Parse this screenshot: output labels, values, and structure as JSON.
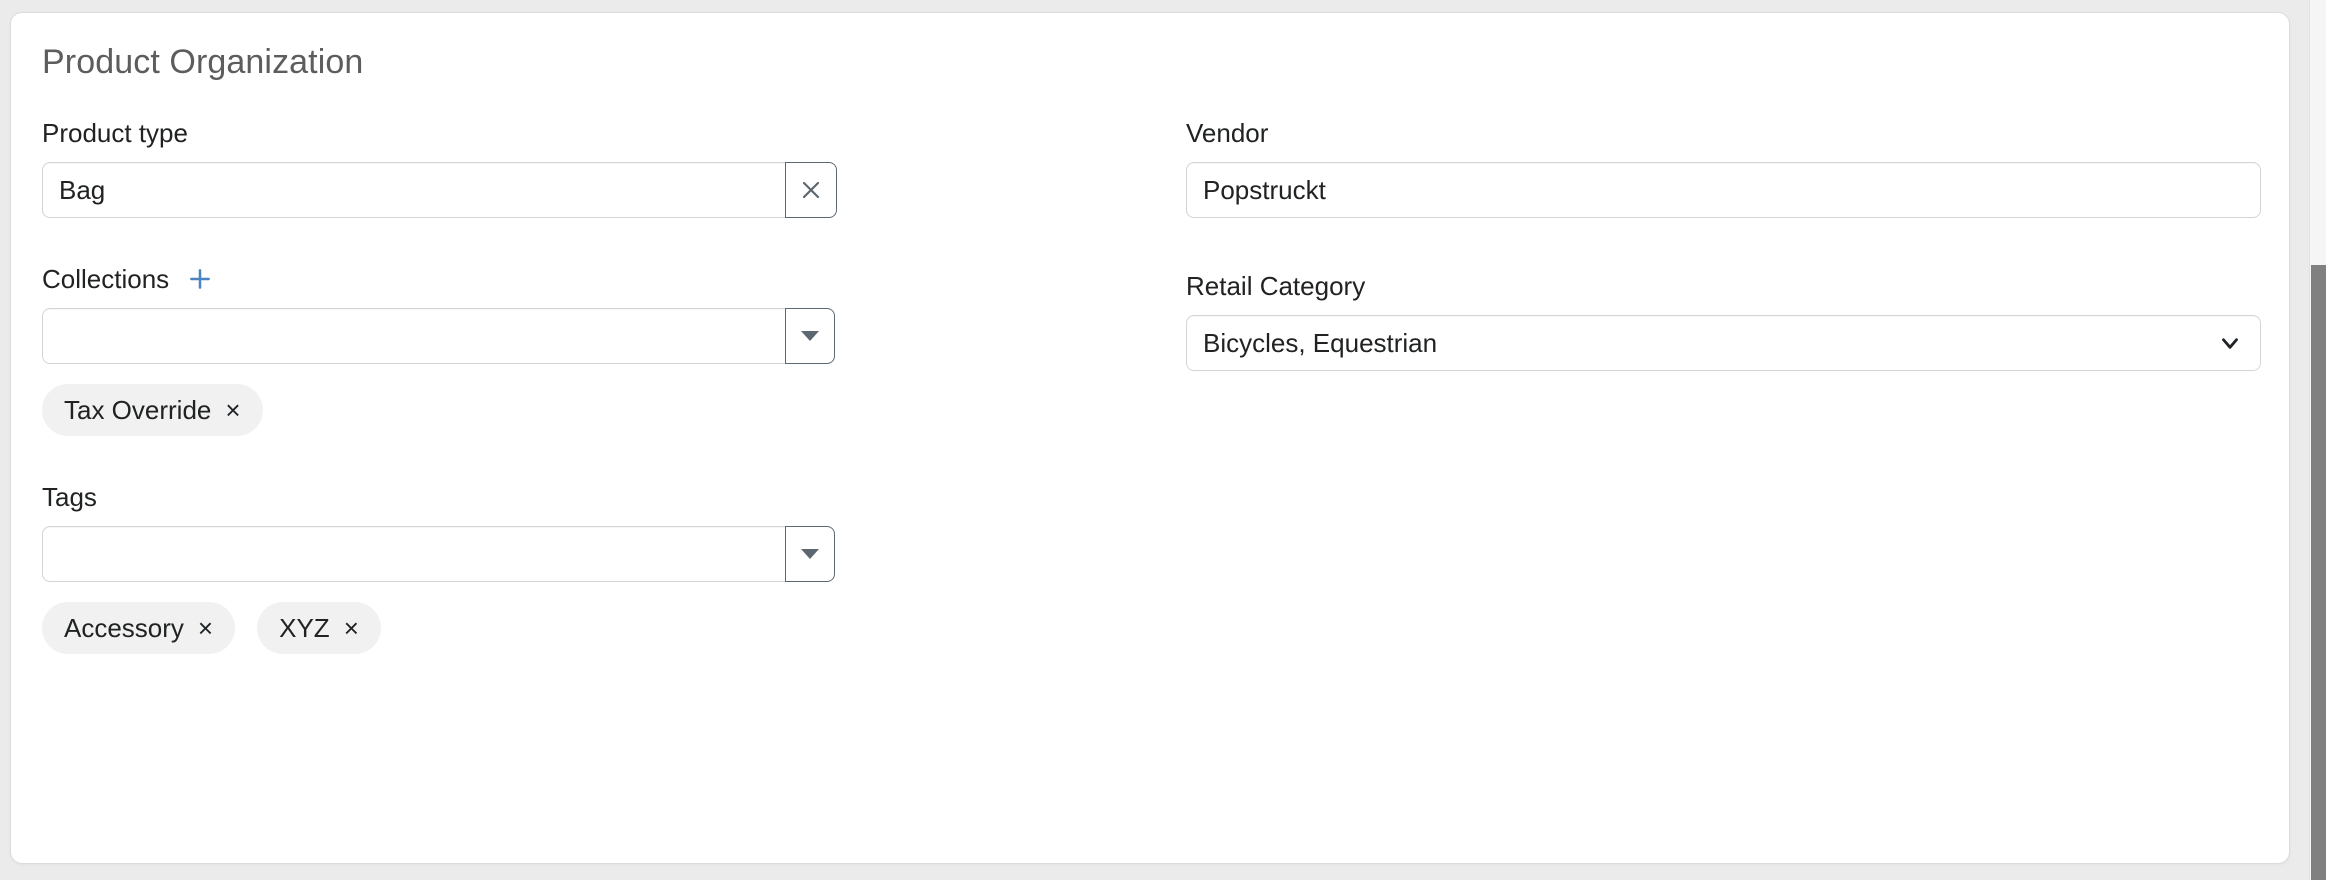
{
  "card": {
    "title": "Product Organization"
  },
  "left_column": {
    "product_type": {
      "label": "Product type",
      "value": "Bag",
      "placeholder": "",
      "clear_icon": "close-icon"
    },
    "collections": {
      "label": "Collections",
      "add_icon": "plus-icon",
      "add_icon_color": "#4b84c4",
      "value": "",
      "placeholder": "",
      "dropdown_icon": "caret-down-icon",
      "chips": [
        {
          "label": "Tax Override",
          "remove_icon": "close-icon"
        }
      ]
    },
    "tags": {
      "label": "Tags",
      "value": "",
      "placeholder": "",
      "dropdown_icon": "caret-down-icon",
      "chips": [
        {
          "label": "Accessory",
          "remove_icon": "close-icon"
        },
        {
          "label": "XYZ",
          "remove_icon": "close-icon"
        }
      ]
    }
  },
  "right_column": {
    "vendor": {
      "label": "Vendor",
      "value": "Popstruckt",
      "placeholder": ""
    },
    "retail_category": {
      "label": "Retail Category",
      "value": "Bicycles, Equestrian",
      "chevron_icon": "chevron-down-icon"
    }
  },
  "colors": {
    "page_background": "#ebebeb",
    "card_background": "#ffffff",
    "card_border": "#dcdcdc",
    "title_text": "#5d5d5d",
    "label_text": "#202223",
    "input_border": "#d2d5d8",
    "button_border": "#5c6771",
    "chip_background": "#f1f1f1",
    "accent_blue": "#4b84c4",
    "scrollbar_thumb": "#808080"
  },
  "scrollbar": {
    "name": "vertical-scrollbar"
  }
}
